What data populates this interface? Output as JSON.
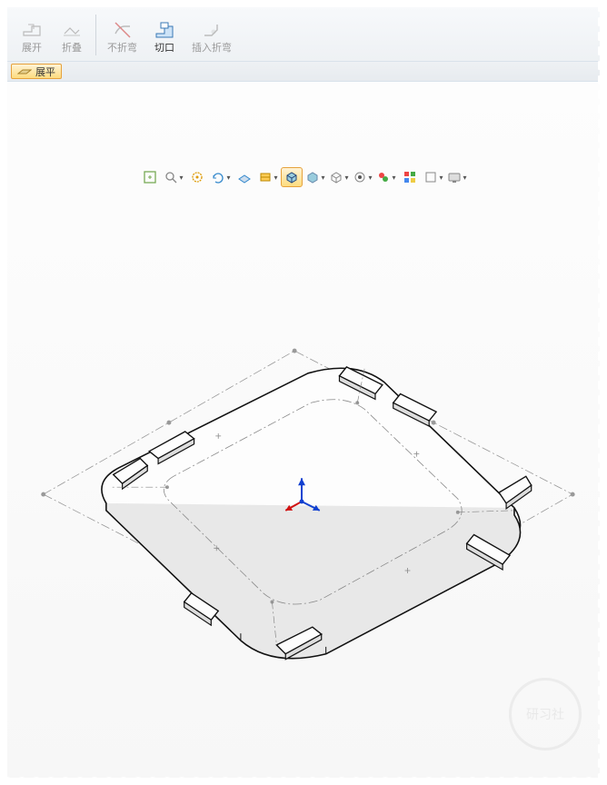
{
  "ribbon": {
    "expand": "展开",
    "collapse": "折叠",
    "no_bend": "不折弯",
    "cut": "切口",
    "insert_bend": "插入折弯"
  },
  "secondary": {
    "flatten": "展平"
  },
  "view_toolbar": {
    "items": [
      {
        "name": "zoom-fit-icon"
      },
      {
        "name": "zoom-area-icon"
      },
      {
        "name": "zoom-icon"
      },
      {
        "name": "rotate-view-icon"
      },
      {
        "name": "pan-icon"
      },
      {
        "name": "section-view-icon"
      },
      {
        "name": "shaded-edges-icon",
        "active": true
      },
      {
        "name": "shaded-icon"
      },
      {
        "name": "wireframe-icon"
      },
      {
        "name": "hidden-lines-icon"
      },
      {
        "name": "perspective-icon"
      },
      {
        "name": "apply-scene-icon"
      },
      {
        "name": "edit-appearance-icon"
      },
      {
        "name": "display-state-icon"
      }
    ]
  },
  "watermark": "研习社"
}
